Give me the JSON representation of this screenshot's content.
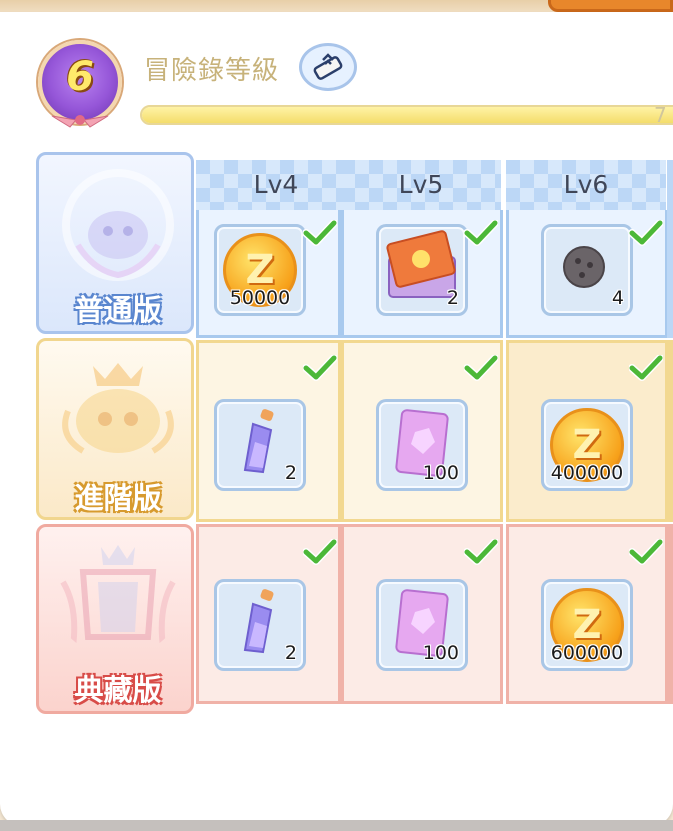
{
  "header": {
    "level": "6",
    "title": "冒險錄等級",
    "progress_text": "7",
    "progress_fraction": 0.97,
    "title_icon": "scroll-icon"
  },
  "columns": [
    {
      "label": "Lv4"
    },
    {
      "label": "Lv5"
    },
    {
      "label": "Lv6"
    }
  ],
  "tiers": [
    {
      "label": "普通版",
      "color": "#6f9fe0"
    },
    {
      "label": "進階版",
      "color": "#e6b04a"
    },
    {
      "label": "典藏版",
      "color": "#e8605a"
    }
  ],
  "rewards": {
    "basic": [
      {
        "item": "zeny-coin-icon",
        "qty": "50000",
        "claimed": true
      },
      {
        "item": "card-pack-icon",
        "qty": "2",
        "claimed": true
      },
      {
        "item": "ore-icon",
        "qty": "4",
        "claimed": true
      }
    ],
    "advanced": [
      {
        "item": "potion-icon",
        "qty": "2",
        "claimed": true
      },
      {
        "item": "crystal-card-icon",
        "qty": "100",
        "claimed": true
      },
      {
        "item": "zeny-coin-icon",
        "qty": "400000",
        "claimed": true
      }
    ],
    "premium": [
      {
        "item": "potion-icon",
        "qty": "2",
        "claimed": true
      },
      {
        "item": "crystal-card-icon",
        "qty": "100",
        "claimed": true
      },
      {
        "item": "zeny-coin-icon",
        "qty": "600000",
        "claimed": true
      }
    ]
  },
  "colors": {
    "check": "#4cb838",
    "progress_fill": "#f4dd6b",
    "badge": "#9556d8"
  }
}
